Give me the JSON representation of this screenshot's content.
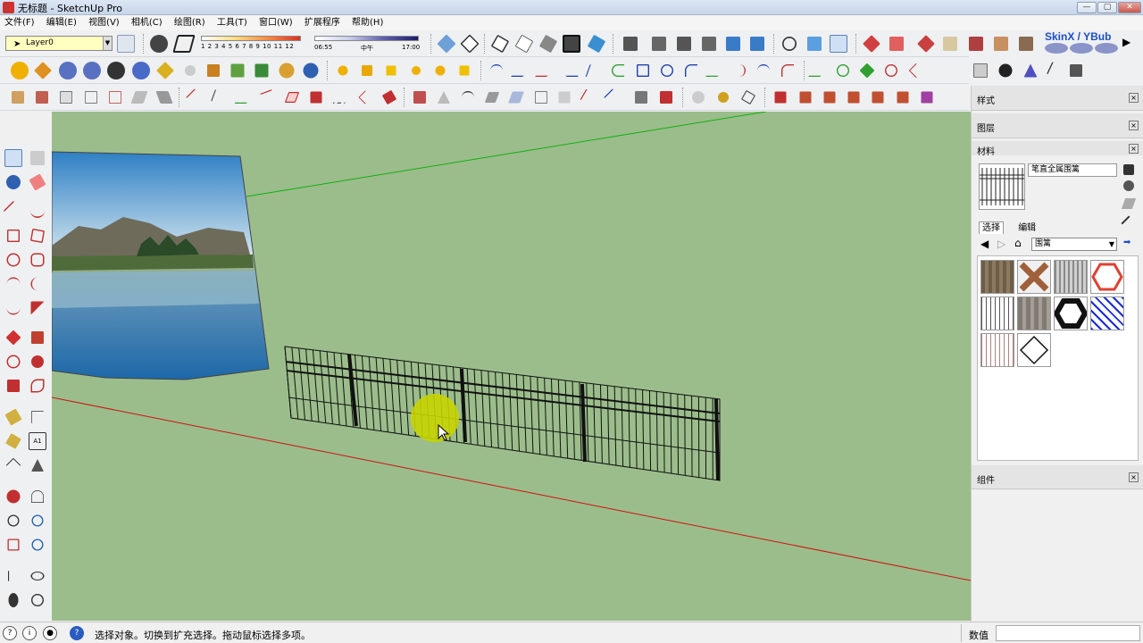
{
  "window": {
    "title": "无标题 - SketchUp Pro"
  },
  "menu": [
    "文件(F)",
    "编辑(E)",
    "视图(V)",
    "相机(C)",
    "绘图(R)",
    "工具(T)",
    "窗口(W)",
    "扩展程序",
    "帮助(H)"
  ],
  "layer": {
    "current": "Layer0"
  },
  "shadow": {
    "scale_numbers": "1 2 3 4 5 6 7 8 9 10 11 12",
    "time_start": "06:55",
    "time_mid": "中午",
    "time_end": "17:00"
  },
  "branding": {
    "skinx": "SkinX / YBub"
  },
  "panels": {
    "styles": "样式",
    "layers": "图层",
    "materials": "材料",
    "components": "组件"
  },
  "materials": {
    "name": "笔直全属围篱",
    "tab_select": "选择",
    "tab_edit": "编辑",
    "category": "围篱",
    "swatches": [
      "wood-fence",
      "lattice-wood",
      "metal-fence",
      "chain-red",
      "rail-fence",
      "plank-fence",
      "black-chain",
      "blue-mesh",
      "picket-fence",
      "diamond-outline"
    ]
  },
  "statusbar": {
    "message": "选择对象。切换到扩充选择。拖动鼠标选择多项。",
    "measurement_label": "数值",
    "measurement_value": ""
  },
  "colors": {
    "viewport": "#9bbd8b",
    "red_axis": "#d01010",
    "green_axis": "#10b010",
    "cursor_highlight": "#c8d400"
  }
}
